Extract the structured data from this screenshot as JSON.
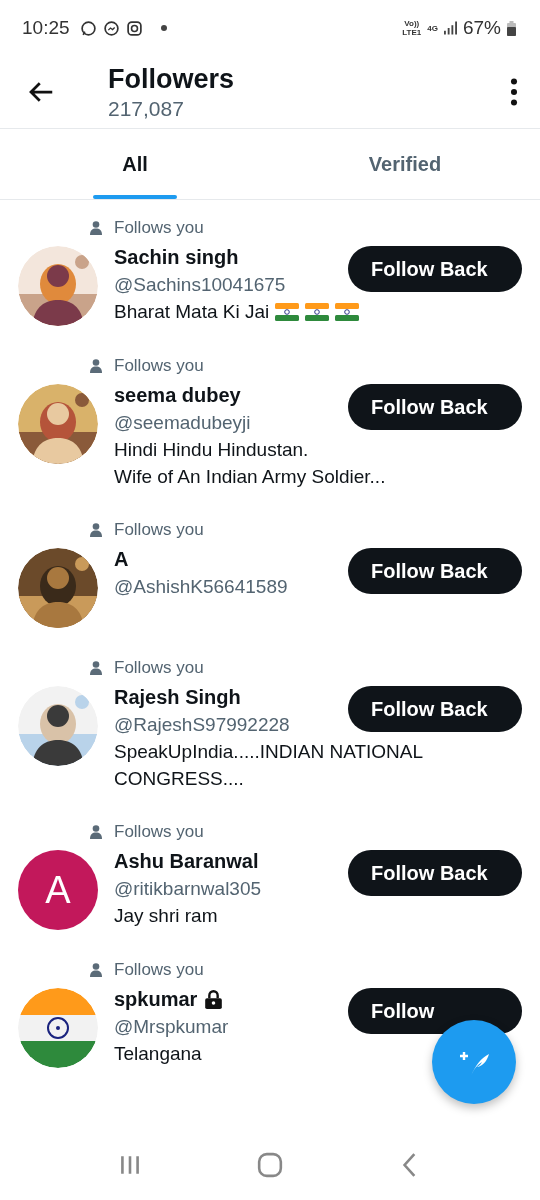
{
  "status_bar": {
    "time": "10:25",
    "network_top": "Vo))",
    "network_bottom": "LTE1",
    "data_type": "4G",
    "battery": "67%"
  },
  "header": {
    "title": "Followers",
    "count": "217,087"
  },
  "tabs": [
    {
      "label": "All",
      "selected": true
    },
    {
      "label": "Verified",
      "selected": false
    }
  ],
  "followers": [
    {
      "context": "Follows you",
      "name": "Sachin singh",
      "handle": "@Sachins10041675",
      "bio": [
        "Bharat Mata Ki Jai"
      ],
      "bio_icons": [
        {
          "kind": "flag"
        },
        {
          "kind": "flag"
        },
        {
          "kind": "flag"
        }
      ],
      "avatar": {
        "kind": "picture"
      },
      "protected": false,
      "button": "Follow Back"
    },
    {
      "context": "Follows you",
      "name": "seema dubey",
      "handle": "@seemadubeyji",
      "bio": [
        "Hindi Hindu Hindustan.",
        "Wife of An Indian Army Soldier..."
      ],
      "avatar": {
        "kind": "picture"
      },
      "protected": false,
      "button": "Follow Back"
    },
    {
      "context": "Follows you",
      "name": "A",
      "handle": "@AshishK56641589",
      "avatar": {
        "kind": "picture"
      },
      "protected": false,
      "button": "Follow Back"
    },
    {
      "context": "Follows you",
      "name": "Rajesh Singh",
      "handle": "@RajeshS97992228",
      "bio": [
        "SpeakUpIndia.....INDIAN NATIONAL",
        "CONGRESS...."
      ],
      "avatar": {
        "kind": "picture"
      },
      "protected": false,
      "button": "Follow Back"
    },
    {
      "context": "Follows you",
      "name": "Ashu Baranwal",
      "handle": "@ritikbarnwal305",
      "bio": [
        "Jay shri ram"
      ],
      "avatar": {
        "kind": "letter",
        "letter": "A",
        "color": "#c2185b"
      },
      "protected": false,
      "button": "Follow Back"
    },
    {
      "context": "Follows you",
      "name": "spkumar",
      "handle": "@Mrspkumar",
      "bio": [
        "Telangana"
      ],
      "avatar": {
        "kind": "flag"
      },
      "protected": true,
      "button": "Follow"
    }
  ]
}
